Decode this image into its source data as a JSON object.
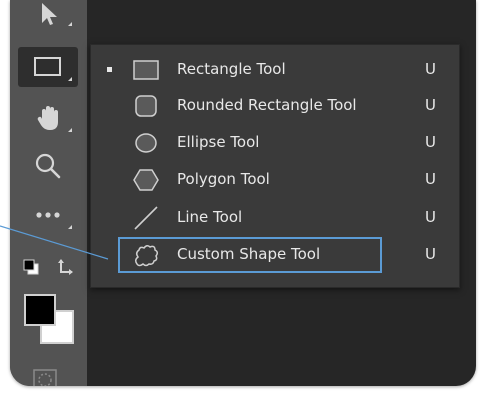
{
  "flyout": {
    "items": [
      {
        "label": "Rectangle Tool",
        "shortcut": "U",
        "icon": "rectangle-icon",
        "selected": true
      },
      {
        "label": "Rounded Rectangle Tool",
        "shortcut": "U",
        "icon": "rounded-rectangle-icon",
        "selected": false
      },
      {
        "label": "Ellipse Tool",
        "shortcut": "U",
        "icon": "ellipse-icon",
        "selected": false
      },
      {
        "label": "Polygon Tool",
        "shortcut": "U",
        "icon": "polygon-icon",
        "selected": false
      },
      {
        "label": "Line Tool",
        "shortcut": "U",
        "icon": "line-icon",
        "selected": false
      },
      {
        "label": "Custom Shape Tool",
        "shortcut": "U",
        "icon": "custom-shape-icon",
        "selected": false
      }
    ]
  },
  "toolbar": {
    "tools": [
      "move-tool-icon",
      "rectangle-tool-icon",
      "hand-tool-icon",
      "zoom-tool-icon",
      "more-tools-icon",
      "default-colors-icon",
      "swap-colors-icon",
      "quick-mask-icon"
    ]
  },
  "colors": {
    "toolbar_bg": "#535353",
    "panel_bg": "#3a3a3a",
    "canvas_bg": "#262626",
    "highlight": "#5b9bd5",
    "foreground": "#000000",
    "background": "#ffffff"
  }
}
